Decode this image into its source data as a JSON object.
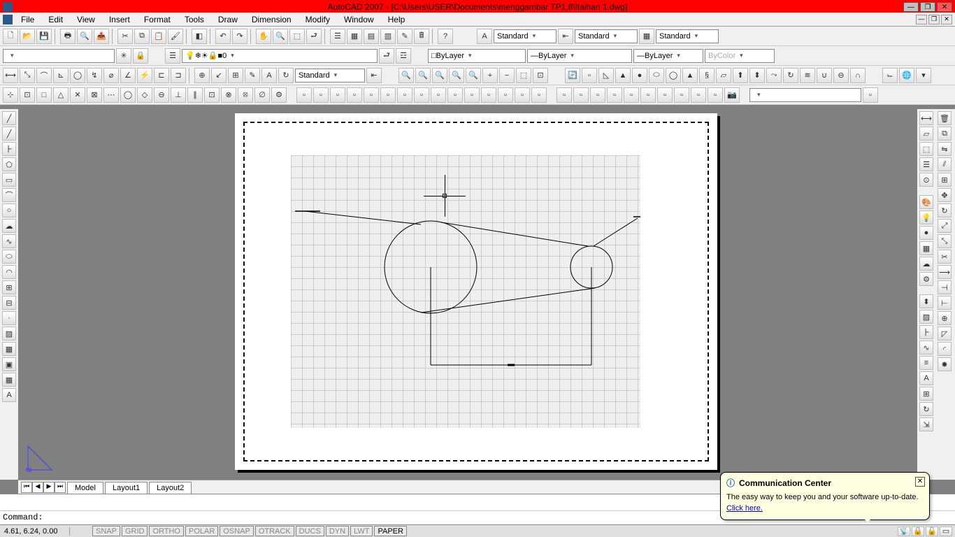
{
  "title": "AutoCAD 2007 - [C:\\Users\\USER\\Documents\\menggambar TP1,8\\Itaihan 1.dwg]",
  "menu": [
    "File",
    "Edit",
    "View",
    "Insert",
    "Format",
    "Tools",
    "Draw",
    "Dimension",
    "Modify",
    "Window",
    "Help"
  ],
  "styles": {
    "text_style": "Standard",
    "dim_style": "Standard",
    "table_style": "Standard"
  },
  "layers": {
    "current": "0",
    "color": "ByLayer",
    "linetype": "ByLayer",
    "lineweight": "ByLayer",
    "plot_style": "ByColor"
  },
  "dim_toolbar_style": "Standard",
  "tabs": {
    "model": "Model",
    "layout1": "Layout1",
    "layout2": "Layout2"
  },
  "command": {
    "prompt": "Command:"
  },
  "status": {
    "coords": "4.61, 6.24, 0.00",
    "toggles": [
      "SNAP",
      "GRID",
      "ORTHO",
      "POLAR",
      "OSNAP",
      "OTRACK",
      "DUCS",
      "DYN",
      "LWT",
      "PAPER"
    ]
  },
  "notification": {
    "title": "Communication Center",
    "body": "The easy way to keep you and your software up-to-date.",
    "link": "Click here."
  }
}
